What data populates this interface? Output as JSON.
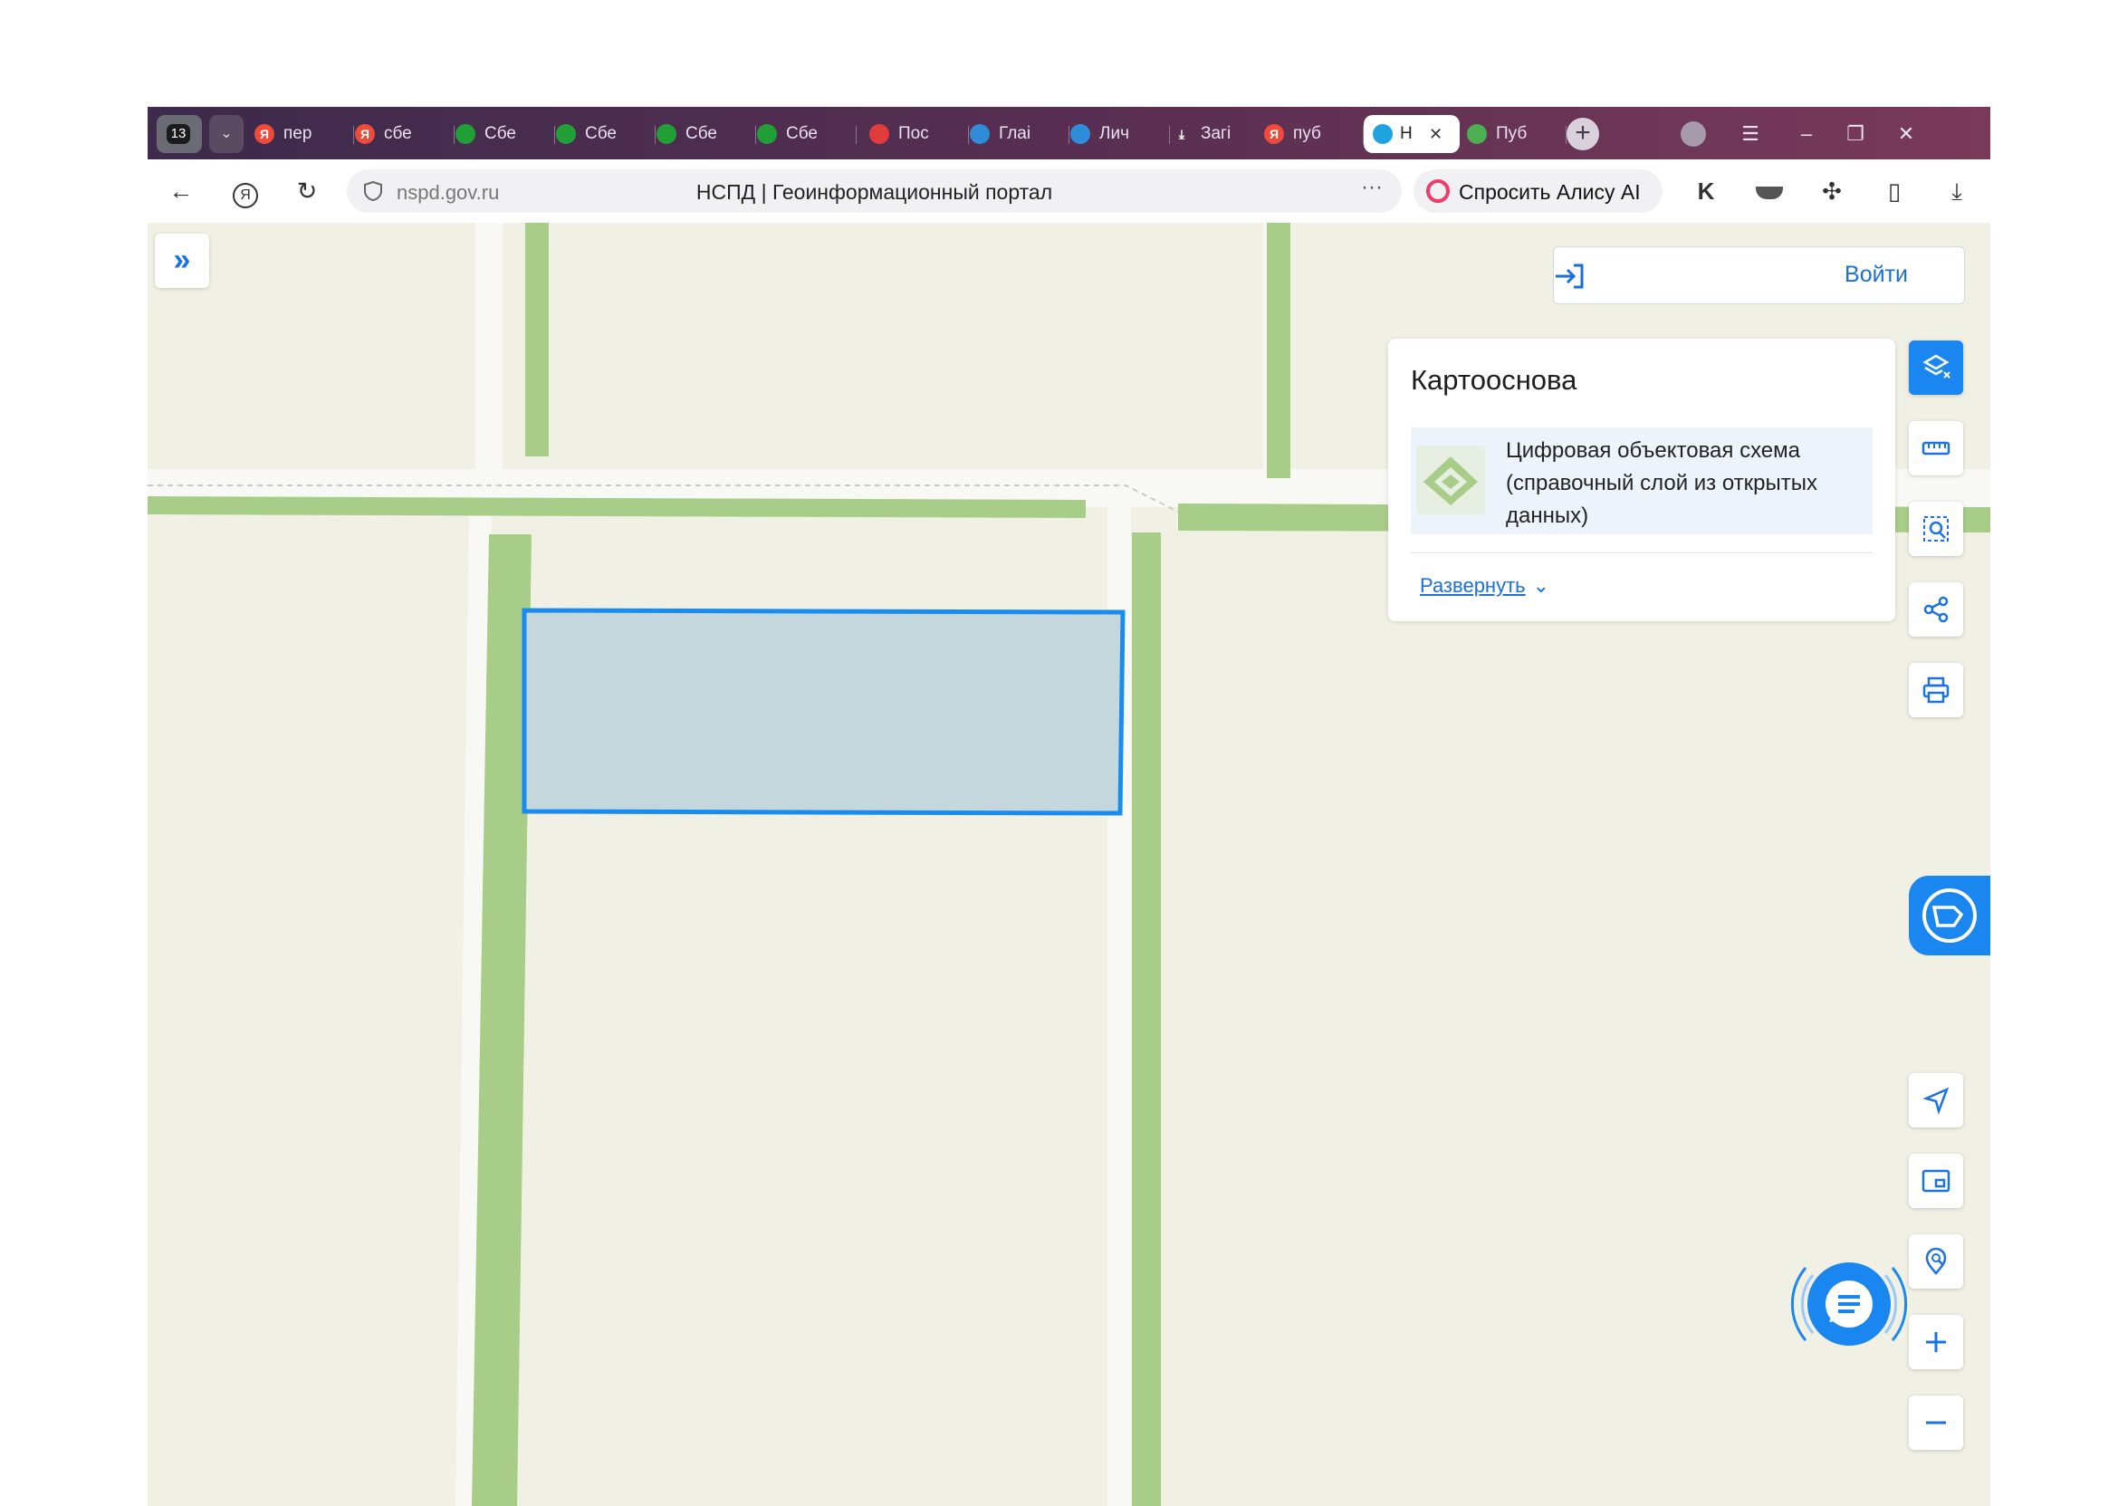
{
  "browser": {
    "tab_count": "13",
    "tabs": [
      {
        "label": "пер",
        "icon": "yandex-icon",
        "color": "#ef4a3a"
      },
      {
        "label": "сбе",
        "icon": "yandex-icon",
        "color": "#ef4a3a"
      },
      {
        "label": "Сбе",
        "icon": "sber-icon",
        "color": "#21a038"
      },
      {
        "label": "Сбе",
        "icon": "sber-icon",
        "color": "#21a038"
      },
      {
        "label": "Сбе",
        "icon": "sber-icon",
        "color": "#21a038"
      },
      {
        "label": "Сбе",
        "icon": "sber-icon",
        "color": "#21a038"
      },
      {
        "label": "Пос",
        "icon": "pdf-icon",
        "color": "#e23b3b"
      },
      {
        "label": "Глаі",
        "icon": "gosuslugi-icon",
        "color": "#2f8cd8"
      },
      {
        "label": "Лич",
        "icon": "gosuslugi-icon",
        "color": "#2f8cd8"
      },
      {
        "label": "Загі",
        "icon": "download-icon",
        "color": "#ffffff"
      },
      {
        "label": "пуб",
        "icon": "yandex-icon",
        "color": "#ef4a3a"
      },
      {
        "label": "Н",
        "icon": "nspd-icon",
        "color": "#1fa3e0",
        "active": true
      },
      {
        "label": "Пуб",
        "icon": "puzzle-color-icon",
        "color": "#4caf50"
      }
    ],
    "url_domain": "nspd.gov.ru",
    "page_title": "НСПД | Геоинформационный портал",
    "alisa_button": "Спросить Алису AI"
  },
  "map": {
    "login_label": "Войти",
    "basemap_panel": {
      "title": "Картооснова",
      "item_label": "Цифровая объектовая схема (справочный слой из открытых данных)",
      "expand_link": "Развернуть"
    },
    "right_tools": [
      "layers-icon",
      "ruler-icon",
      "select-area-icon",
      "share-icon",
      "print-icon"
    ],
    "bottom_tools": [
      "locate-icon",
      "minimap-icon",
      "search-location-icon",
      "zoom-in-icon",
      "zoom-out-icon"
    ],
    "colors": {
      "accent": "#1a86f0",
      "map_bg": "#f0f0e4",
      "green_strip": "#a8cd89",
      "parcel_fill": "#c3d7dc",
      "parcel_stroke": "#1a8cf0"
    }
  }
}
